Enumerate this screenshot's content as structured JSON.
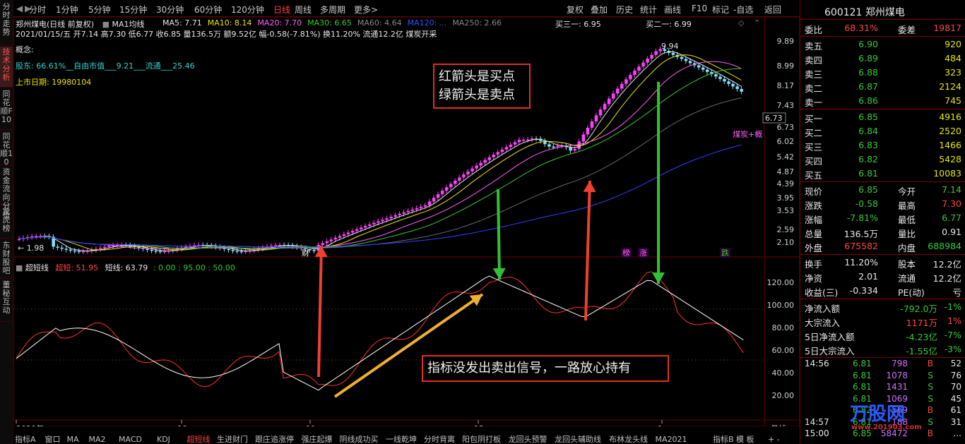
{
  "left_tabs": [
    {
      "label": "分时走势"
    },
    {
      "label": "技术分析",
      "active": true
    },
    {
      "label": "同花顺F10"
    },
    {
      "label": "同花顺10"
    },
    {
      "label": "资金流向分析"
    },
    {
      "label": "龙虎榜"
    },
    {
      "label": "东财股吧"
    },
    {
      "label": "董秘互动"
    }
  ],
  "toolbar": {
    "items": [
      "分时",
      "1分钟",
      "5分钟",
      "15分钟",
      "30分钟",
      "60分钟",
      "120分钟",
      "日线",
      "周线",
      "多周期",
      "更多>"
    ],
    "active": "日线",
    "right_items": [
      "复权",
      "叠加",
      "历史",
      "统计",
      "画线",
      "F10",
      "标记",
      "-自选",
      "返回"
    ]
  },
  "header": {
    "stock_line": "郑州煤电(日线 前复权)",
    "ma_label": "MA1均线",
    "ma_values": [
      {
        "text": "MA5: 7.71",
        "color": "#e8e8e8"
      },
      {
        "text": "MA10: 8.14",
        "color": "#e8e800"
      },
      {
        "text": "MA20: 7.70",
        "color": "#ff60ff"
      },
      {
        "text": "MA30: 6.65",
        "color": "#33cc33"
      },
      {
        "text": "MA60: 4.64",
        "color": "#888888"
      },
      {
        "text": "MA120: ...",
        "color": "#3050ff"
      },
      {
        "text": "MA250: 2.66",
        "color": "#888888"
      }
    ],
    "day_line": "2021/01/15/五 开7.14 高7.30 低6.77 收6.85 量136.5万 额9.52亿 幅-0.58(-7.81%) 换11.20% 流通12.2亿 煤炭开采",
    "sell3": "买三一: 6.95",
    "buy2": "买二一: 6.99",
    "concept_label": "概念:",
    "holder_line": "股东:     66.61%__自由市值___9.21___流通___25.46",
    "list_date": "上市日期: 19980104"
  },
  "price_axis": [
    "9.89",
    "8.99",
    "8.17",
    "7.43",
    "6.73",
    "6.02",
    "5.42",
    "4.87",
    "4.39",
    "3.95",
    "3.53",
    "2.59",
    "2.10"
  ],
  "last_price_tag": "6.73",
  "high_label": "9.94",
  "low_label": "1.98",
  "tags": {
    "cai": "财",
    "bang": "榜",
    "zhang": "涨",
    "die": "跌",
    "coal": "煤炭+概"
  },
  "annotations": {
    "box1": "红箭头是买点\n绿箭头是卖点",
    "box2": "指标没发出卖出信号，一路放心持有"
  },
  "indicator": {
    "name": "超短线",
    "v1_label": "超短: 51.95",
    "v2_label": "短线: 63.79",
    "v3_label": ": 0.00 : 95.00 : 50.00",
    "axis": [
      "120.00",
      "100.00",
      "80.00",
      "60.00",
      "40.00",
      "20.00"
    ]
  },
  "date_axis": [
    "2020年",
    "10",
    "11",
    "12",
    "1"
  ],
  "date_right": "日线",
  "bottom_tabs": [
    "指标A",
    "窗口",
    "MA",
    "MA2",
    "MACD",
    "KDJ",
    "超短线",
    "生进财门",
    "跟庄追涨停",
    "强庄起爆",
    "阴线成功买",
    "一线乾坤",
    "分时背离",
    "阳包阴打板",
    "龙回头预警",
    "龙回头辅助线",
    "布林龙头线",
    "MA2021"
  ],
  "bottom_active": "超短线",
  "bottom_right": "指标B 模 板",
  "quote": {
    "code_name": "600121 郑州煤电",
    "weibi_label": "委比",
    "weibi": "68.31%",
    "weicha_label": "委差",
    "weicha": "19817",
    "sell": [
      {
        "label": "卖五",
        "price": "6.90",
        "vol": "920"
      },
      {
        "label": "卖四",
        "price": "6.89",
        "vol": "484"
      },
      {
        "label": "卖三",
        "price": "6.88",
        "vol": "323"
      },
      {
        "label": "卖二",
        "price": "6.87",
        "vol": "2124"
      },
      {
        "label": "卖一",
        "price": "6.86",
        "vol": "745"
      }
    ],
    "buy": [
      {
        "label": "买一",
        "price": "6.85",
        "vol": "4916"
      },
      {
        "label": "买二",
        "price": "6.84",
        "vol": "2520"
      },
      {
        "label": "买三",
        "price": "6.83",
        "vol": "1466"
      },
      {
        "label": "买四",
        "price": "6.82",
        "vol": "5428"
      },
      {
        "label": "买五",
        "price": "6.81",
        "vol": "10083"
      }
    ],
    "stats": [
      {
        "l1": "现价",
        "v1": "6.85",
        "c1": "green",
        "l2": "今开",
        "v2": "7.14",
        "c2": "green"
      },
      {
        "l1": "涨跌",
        "v1": "-0.58",
        "c1": "green",
        "l2": "最高",
        "v2": "7.30",
        "c2": "red"
      },
      {
        "l1": "涨幅",
        "v1": "-7.81%",
        "c1": "green",
        "l2": "最低",
        "v2": "6.77",
        "c2": "green"
      },
      {
        "l1": "总量",
        "v1": "136.5万",
        "c1": "white",
        "l2": "量比",
        "v2": "0.91",
        "c2": "white"
      },
      {
        "l1": "外盘",
        "v1": "675582",
        "c1": "red",
        "l2": "内盘",
        "v2": "688984",
        "c2": "green"
      }
    ],
    "stats2": [
      {
        "l1": "换手",
        "v1": "11.20%",
        "l2": "股本",
        "v2": "12.2亿"
      },
      {
        "l1": "净资",
        "v1": "2.01",
        "l2": "流通",
        "v2": "12.2亿"
      },
      {
        "l1": "收益(三)",
        "v1": "-0.334",
        "l2": "PE(动)",
        "v2": "亏"
      }
    ],
    "flows": [
      {
        "label": "净流入额",
        "value": "-792.0万",
        "pct": "-1%",
        "color": "green"
      },
      {
        "label": "大宗流入",
        "value": "1171万",
        "pct": "1%",
        "color": "red"
      },
      {
        "label": "5日净流入额",
        "value": "-4.23亿",
        "pct": "-7%",
        "color": "green"
      },
      {
        "label": "5日大宗流入",
        "value": "-1.55亿",
        "pct": "-3%",
        "color": "green"
      }
    ],
    "ticks": [
      {
        "time": "14:56",
        "price": "6.81",
        "vol": "798",
        "bs": "B",
        "n": "52"
      },
      {
        "time": "",
        "price": "6.81",
        "vol": "1078",
        "bs": "S",
        "n": "76"
      },
      {
        "time": "",
        "price": "6.81",
        "vol": "1431",
        "bs": "S",
        "n": "70"
      },
      {
        "time": "",
        "price": "6.81",
        "vol": "1069",
        "bs": "S",
        "n": "45"
      },
      {
        "time": "",
        "price": "6.82",
        "vol": "569",
        "bs": "B",
        "n": "61"
      },
      {
        "time": "14:57",
        "price": "6.81",
        "vol": "188",
        "bs": "S",
        "n": "31"
      },
      {
        "time": "15:00",
        "price": "6.85",
        "vol": "58472",
        "bs": "B",
        "n": "..."
      }
    ],
    "watermark": "万股网",
    "watermark_url": "www.201903.com"
  }
}
